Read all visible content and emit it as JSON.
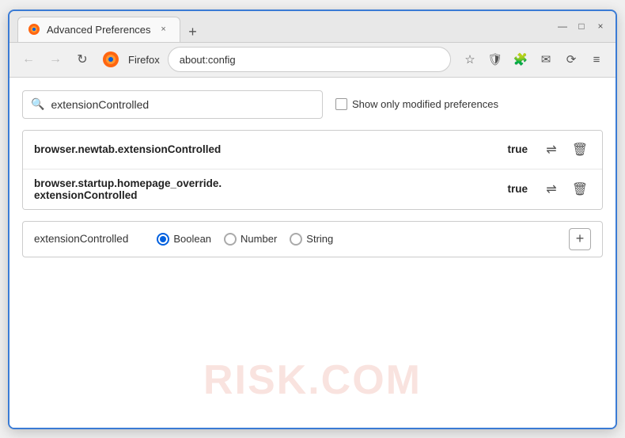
{
  "window": {
    "title": "Advanced Preferences",
    "tab_label": "Advanced Preferences",
    "close_label": "×",
    "new_tab_label": "+",
    "minimize_label": "—",
    "maximize_label": "□",
    "window_close_label": "×"
  },
  "nav": {
    "back_label": "←",
    "forward_label": "→",
    "reload_label": "↻",
    "browser_name": "Firefox",
    "url": "about:config",
    "bookmark_icon": "☆",
    "shield_icon": "🛡",
    "ext_icon": "🧩",
    "mail_icon": "✉",
    "acct_icon": "⟳",
    "menu_icon": "≡"
  },
  "search": {
    "value": "extensionControlled",
    "placeholder": "extensionControlled",
    "show_modified_label": "Show only modified preferences"
  },
  "results": [
    {
      "name": "browser.newtab.extensionControlled",
      "value": "true"
    },
    {
      "name_line1": "browser.startup.homepage_override.",
      "name_line2": "extensionControlled",
      "value": "true"
    }
  ],
  "new_pref": {
    "name": "extensionControlled",
    "type_options": [
      "Boolean",
      "Number",
      "String"
    ],
    "selected_type": "Boolean",
    "add_label": "+"
  },
  "watermark": "RISK.COM",
  "icons": {
    "search": "🔍",
    "toggle": "⇌",
    "delete": "🗑",
    "radio_selected": "●",
    "radio_unselected": "○"
  }
}
